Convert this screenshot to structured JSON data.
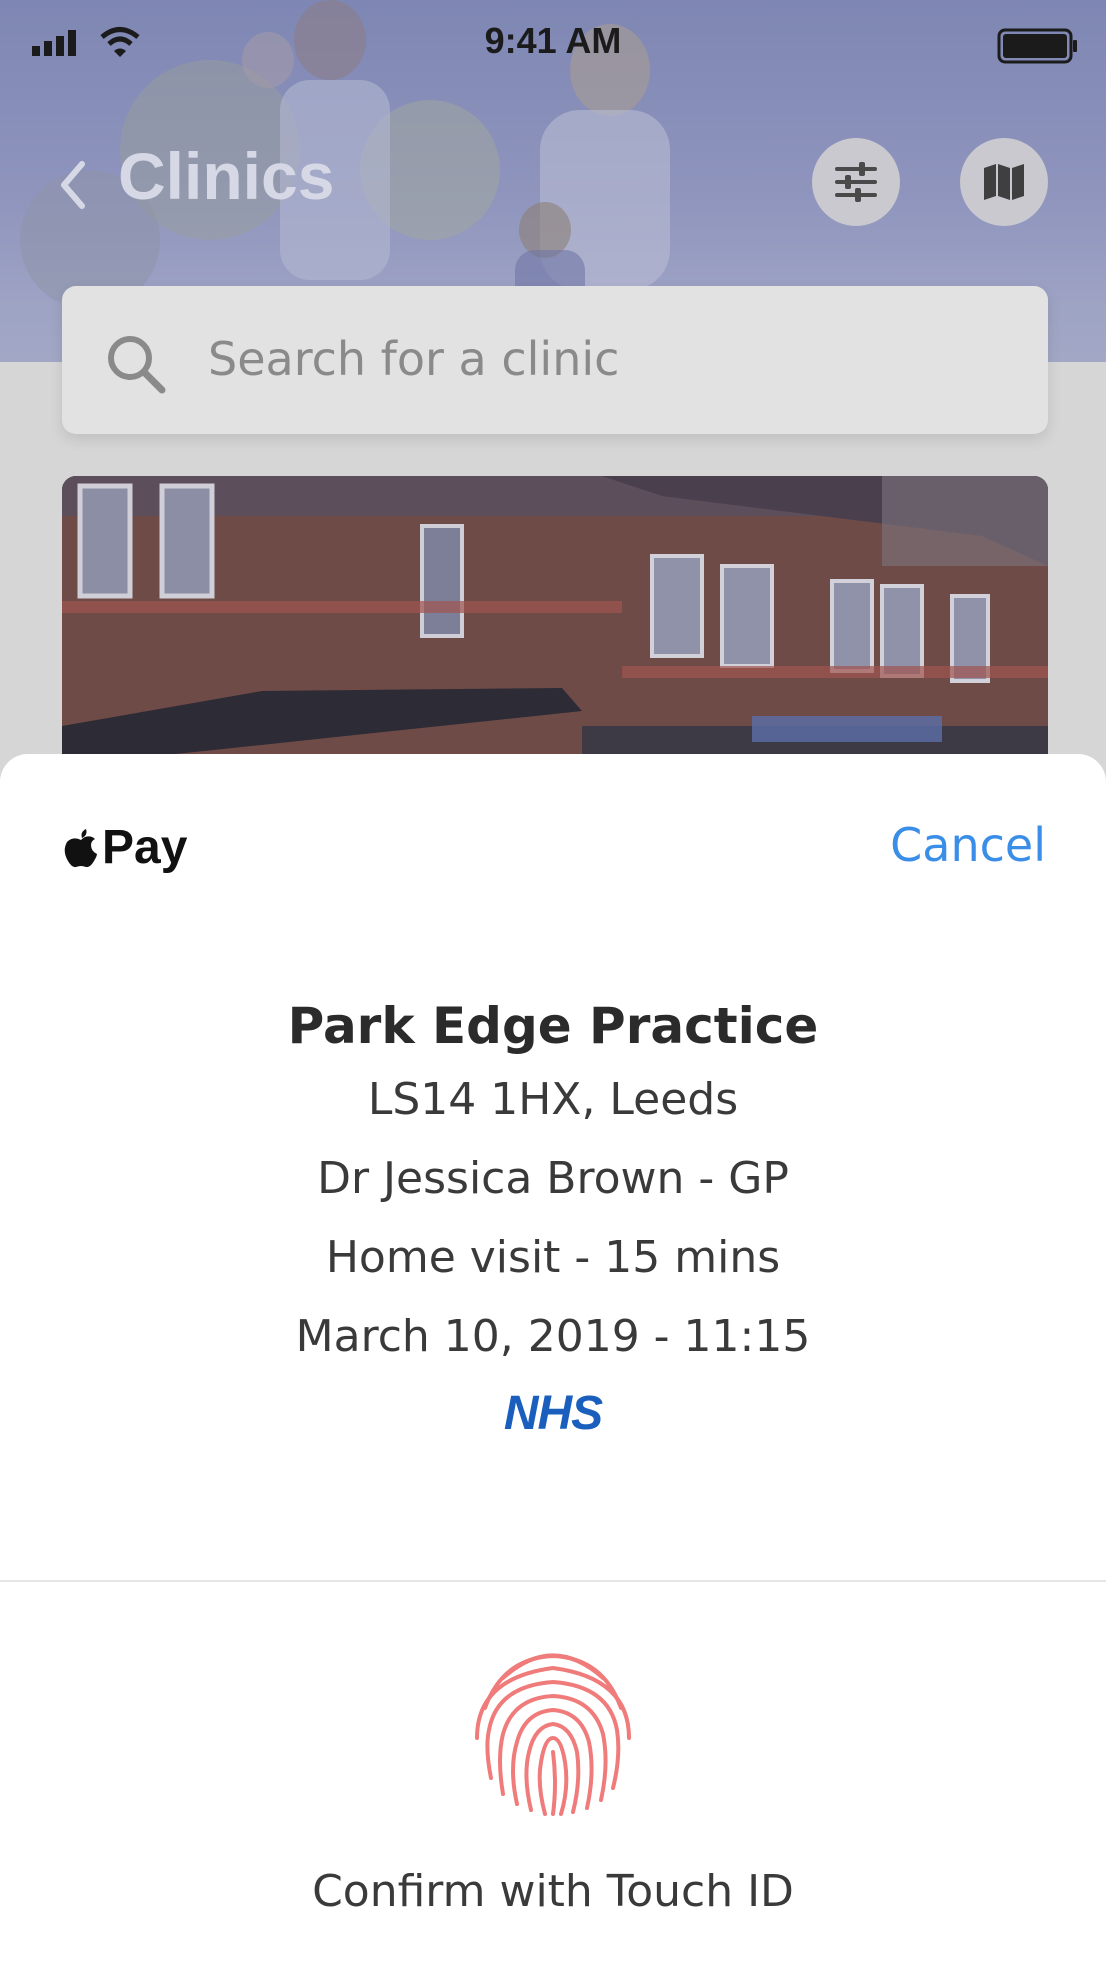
{
  "status_bar": {
    "time": "9:41 AM"
  },
  "nav": {
    "title": "Clinics",
    "back_icon": "chevron-left-icon",
    "filter_icon": "sliders-icon",
    "map_icon": "map-icon"
  },
  "search": {
    "placeholder": "Search for a clinic"
  },
  "apple_pay": {
    "brand_label": "Pay",
    "cancel_label": "Cancel",
    "practice_name": "Park Edge Practice",
    "address": "LS14 1HX, Leeds",
    "doctor": "Dr Jessica Brown - GP",
    "appointment_type": "Home visit - 15 mins",
    "date_time": "March 10, 2019 - 11:15",
    "provider_logo": "NHS",
    "touch_id_label": "Confirm with Touch ID"
  },
  "colors": {
    "accent": "#3b8ee8",
    "nhs_blue": "#1a5fbd",
    "fingerprint": "#f07b7b"
  }
}
